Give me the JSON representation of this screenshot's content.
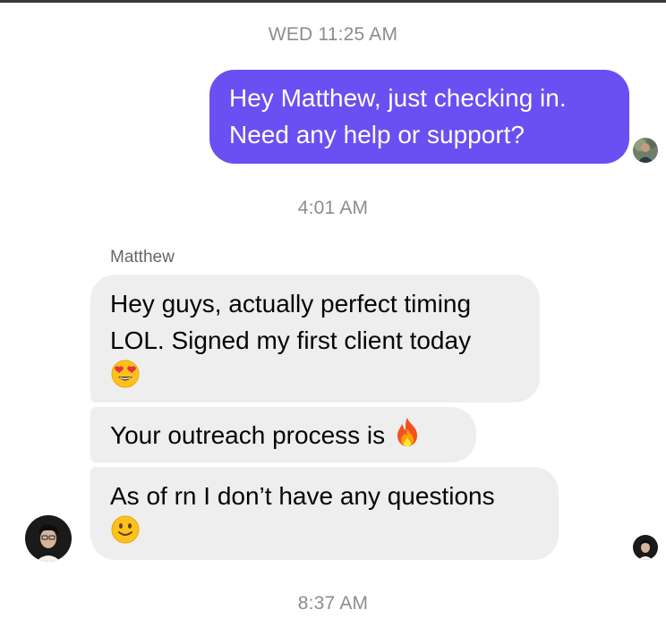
{
  "timestamps": {
    "first": "WED 11:25 AM",
    "second": "4:01 AM",
    "third": "8:37 AM"
  },
  "outgoing_message": {
    "lines": [
      "Hey Matthew, just checking in.",
      "Need any help or support?"
    ],
    "color": "#6a4ff2"
  },
  "incoming": {
    "sender_name": "Matthew",
    "messages": [
      {
        "lines": [
          "Hey guys, actually perfect timing",
          "LOL. Signed my first client today"
        ],
        "emoji": "heart-eyes-emoji"
      },
      {
        "lines": [
          "Your outreach process is"
        ],
        "emoji": "fire-emoji"
      },
      {
        "lines": [
          "As of rn I don’t have any questions"
        ],
        "emoji": "slightly-smiling-emoji"
      }
    ],
    "bubble_color": "#eeeeef"
  },
  "avatars": {
    "me": "user-avatar",
    "matthew": "matthew-avatar",
    "seen_receipt": "seen-receipt-avatar"
  }
}
